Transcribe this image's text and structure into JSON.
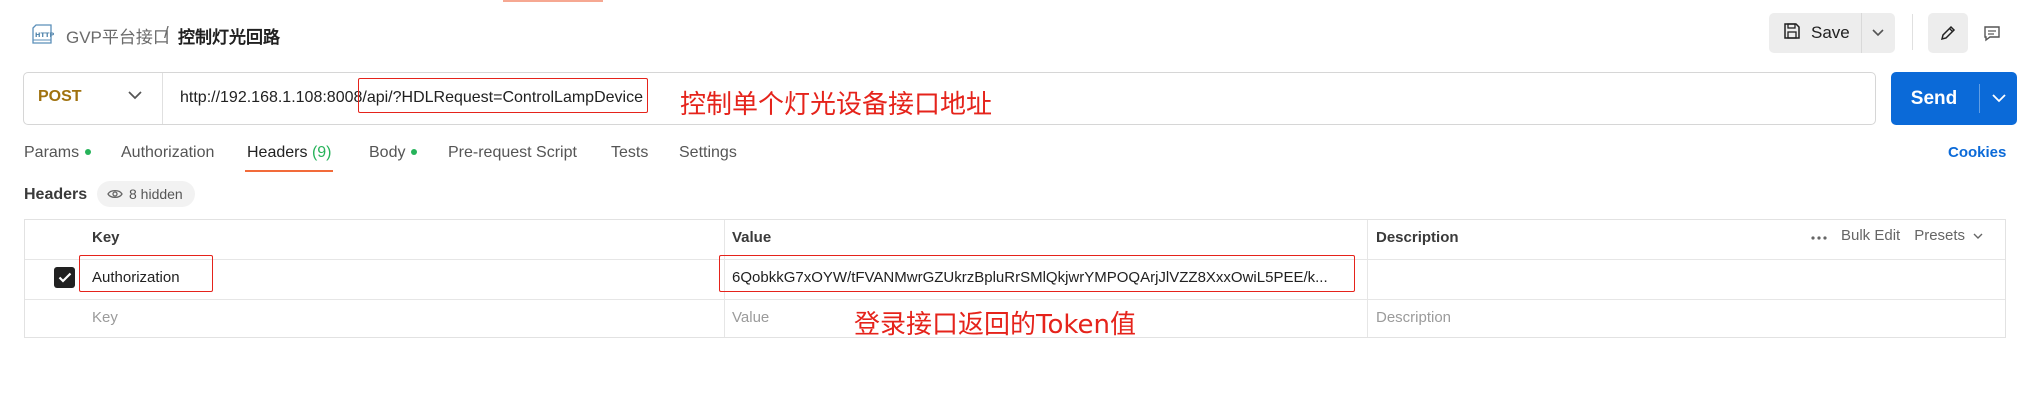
{
  "breadcrumb": {
    "collection": "GVP平台接口",
    "separator": "/",
    "request": "控制灯光回路"
  },
  "toolbar": {
    "save_label": "Save"
  },
  "request": {
    "method": "POST",
    "url": "http://192.168.1.108:8008/api/?HDLRequest=ControlLampDevice",
    "send_label": "Send"
  },
  "tabs": [
    {
      "label": "Params",
      "dot": true
    },
    {
      "label": "Authorization"
    },
    {
      "label": "Headers",
      "count": "(9)",
      "active": true
    },
    {
      "label": "Body",
      "dot": true
    },
    {
      "label": "Pre-request Script"
    },
    {
      "label": "Tests"
    },
    {
      "label": "Settings"
    }
  ],
  "cookies_label": "Cookies",
  "headers_section": {
    "title": "Headers",
    "hidden_label": "8 hidden"
  },
  "table": {
    "columns": {
      "key": "Key",
      "value": "Value",
      "description": "Description"
    },
    "bulk_edit": "Bulk Edit",
    "presets": "Presets",
    "rows": [
      {
        "key": "Authorization",
        "value": "6QobkkG7xOYW/tFVANMwrGZUkrzBpluRrSMlQkjwrYMPOQArjJlVZZ8XxxOwiL5PEE/k...",
        "checked": true
      }
    ],
    "placeholders": {
      "key": "Key",
      "value": "Value",
      "description": "Description"
    }
  },
  "annotations": {
    "url_note": "控制单个灯光设备接口地址",
    "token_note": "登录接口返回的Token值"
  },
  "colors": {
    "accent": "#f26b3a",
    "send": "#0b6ad8",
    "method": "#a0720f",
    "annotation": "#e5231b",
    "dot": "#26b35a"
  }
}
